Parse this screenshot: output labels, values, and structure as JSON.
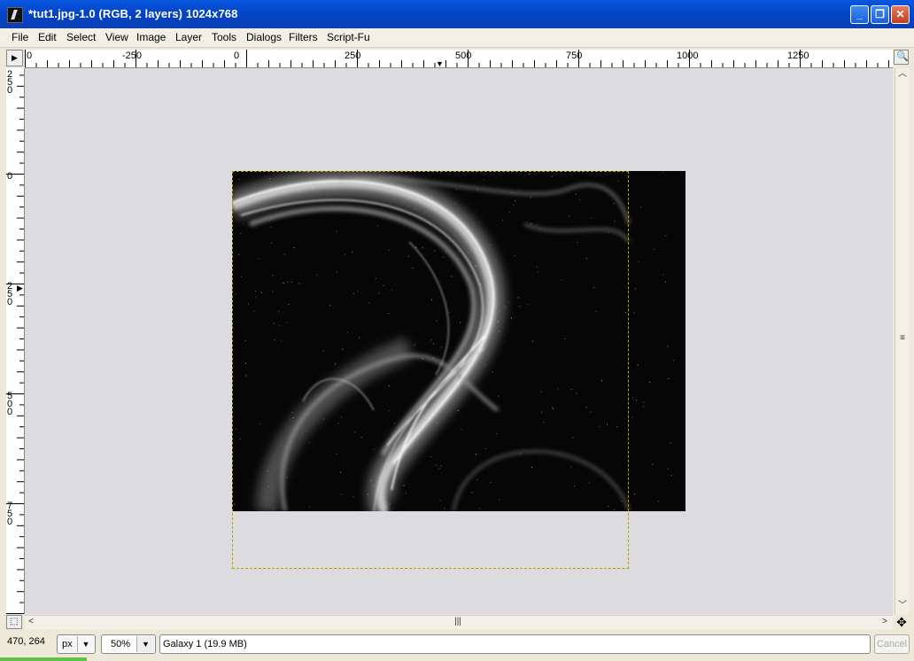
{
  "window": {
    "title": "*tut1.jpg-1.0 (RGB, 2 layers) 1024x768",
    "minimize_icon": "minimize-icon",
    "maximize_icon": "restore-icon",
    "close_icon": "close-icon"
  },
  "menu": [
    "File",
    "Edit",
    "Select",
    "View",
    "Image",
    "Layer",
    "Tools",
    "Dialogs",
    "Filters",
    "Script-Fu"
  ],
  "rulers": {
    "horizontal_labels": [
      "0",
      "-250",
      "0",
      "250",
      "500",
      "750",
      "1000",
      "1250"
    ],
    "vertical_labels": [
      "250",
      "0",
      "250",
      "500",
      "750"
    ]
  },
  "status": {
    "coords": "470, 264",
    "unit": "px",
    "zoom": "50%",
    "layer_info": "Galaxy 1 (19.9 MB)",
    "cancel_label": "Cancel"
  },
  "colors": {
    "titlebar": "#0344c9",
    "canvas_bg": "#dcdbe0",
    "selection_border": "#b8a000"
  }
}
